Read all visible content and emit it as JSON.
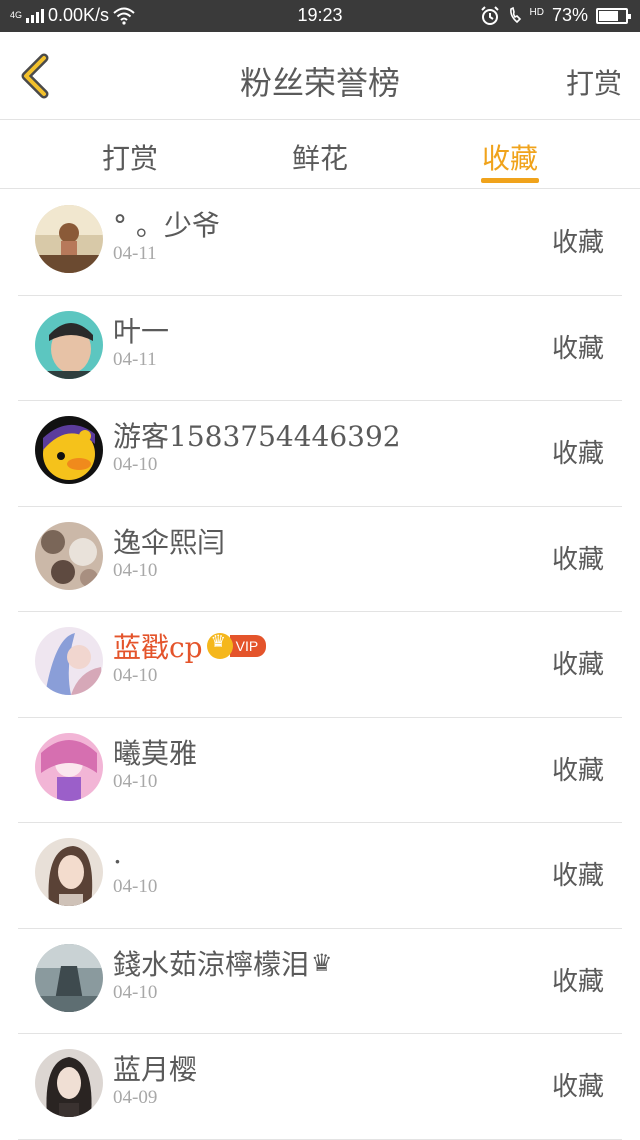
{
  "status_bar": {
    "network": "4G",
    "speed": "0.00K/s",
    "time": "19:23",
    "hd_label": "HD",
    "battery": "73%",
    "battery_level": 0.73
  },
  "header": {
    "title": "粉丝荣誉榜",
    "action_label": "打赏",
    "back_icon": "chevron-left-icon"
  },
  "tabs": [
    {
      "label": "打赏",
      "active": false
    },
    {
      "label": "鲜花",
      "active": false
    },
    {
      "label": "收藏",
      "active": true
    }
  ],
  "colors": {
    "accent": "#f0a31c",
    "vip_name": "#e4542b",
    "text": "#5a5a5a",
    "muted": "#a8a8a8"
  },
  "rows": [
    {
      "name": "° 。少爷",
      "date": "04-11",
      "action": "收藏"
    },
    {
      "name": "叶一",
      "date": "04-11",
      "action": "收藏"
    },
    {
      "name": "游客1583754446392",
      "date": "04-10",
      "action": "收藏"
    },
    {
      "name": "逸伞熙闫",
      "date": "04-10",
      "action": "收藏"
    },
    {
      "name": "蓝戳cp",
      "date": "04-10",
      "action": "收藏",
      "vip_label": "VIP"
    },
    {
      "name": "曦莫雅",
      "date": "04-10",
      "action": "收藏"
    },
    {
      "name": ".",
      "date": "04-10",
      "action": "收藏"
    },
    {
      "name": "錢水茹涼檸檬泪",
      "date": "04-10",
      "action": "收藏",
      "suffix": "♛"
    },
    {
      "name": "蓝月樱",
      "date": "04-09",
      "action": "收藏"
    }
  ]
}
